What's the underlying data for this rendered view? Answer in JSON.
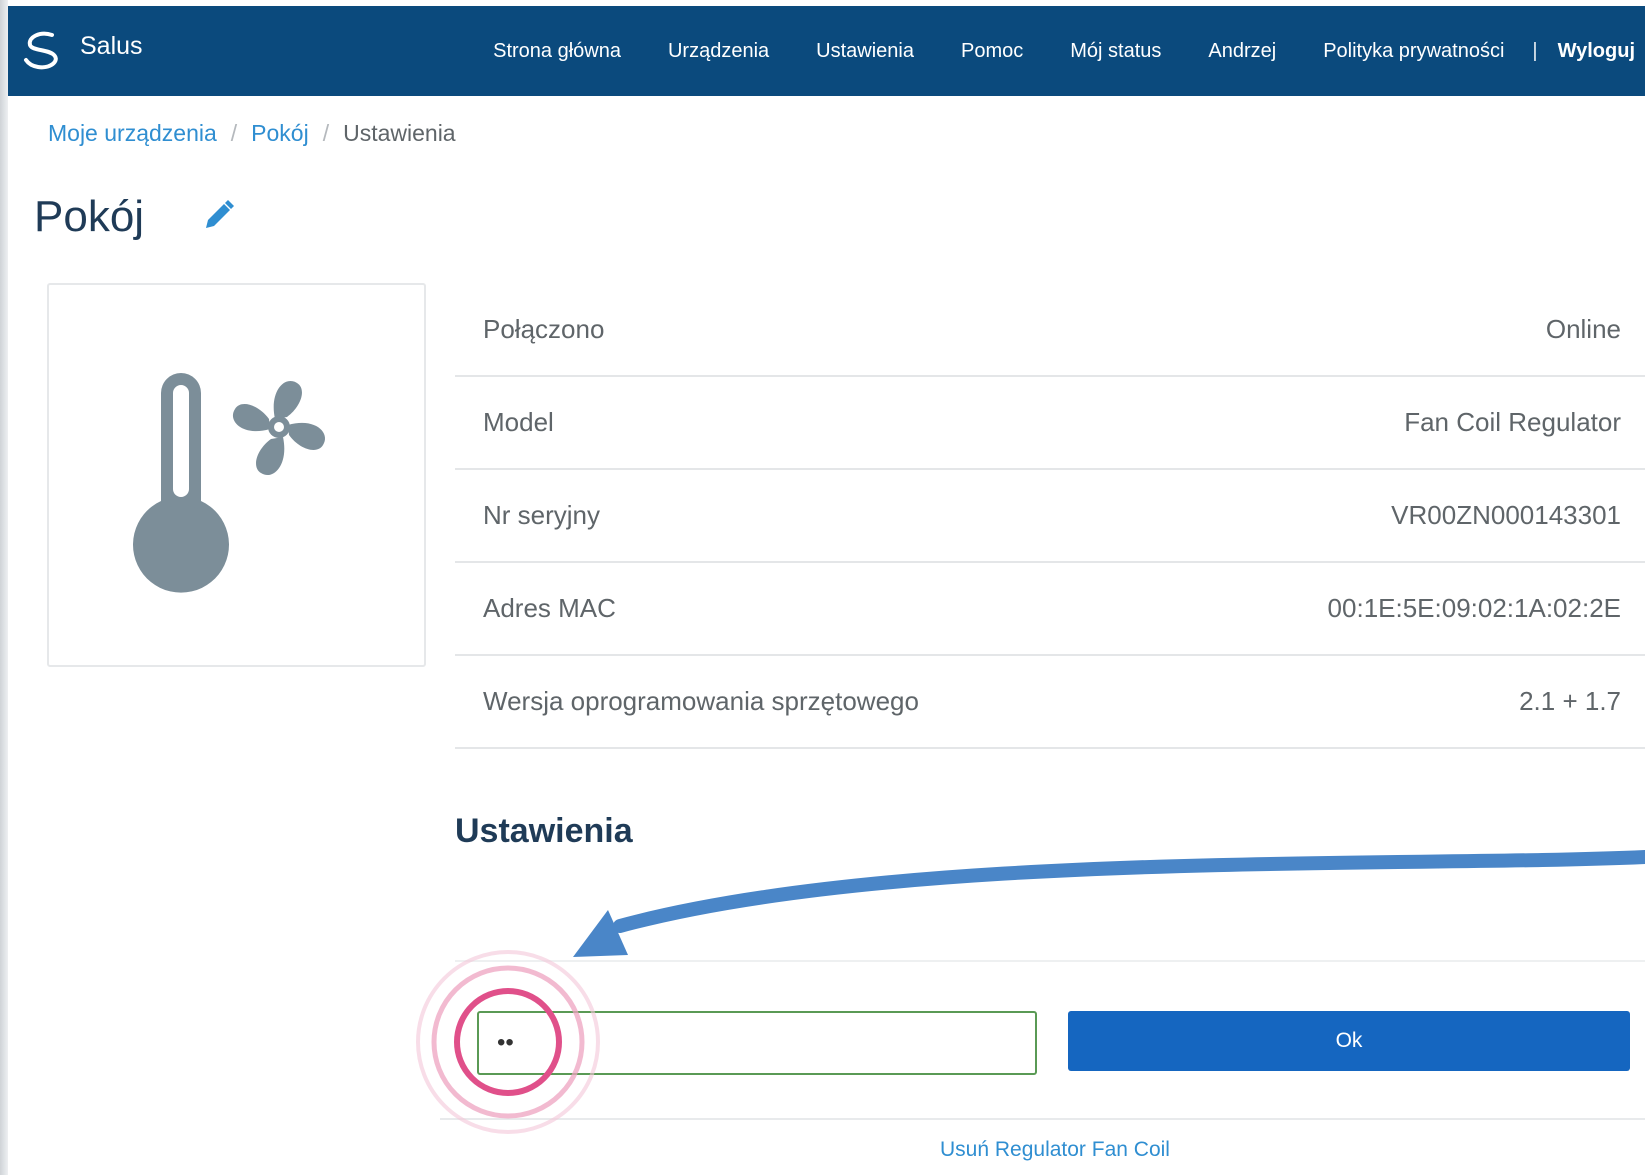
{
  "navbar": {
    "brand": "Salus",
    "items": [
      "Strona główna",
      "Urządzenia",
      "Ustawienia",
      "Pomoc",
      "Mój status",
      "Andrzej",
      "Polityka prywatności"
    ],
    "separator": "|",
    "logout": "Wyloguj"
  },
  "breadcrumb": {
    "items": [
      "Moje urządzenia",
      "Pokój"
    ],
    "separator": "/",
    "current": "Ustawienia"
  },
  "page": {
    "title": "Pokój"
  },
  "device_icon": "thermometer-fan-icon",
  "info": [
    {
      "label": "Połączono",
      "value": "Online"
    },
    {
      "label": "Model",
      "value": "Fan Coil Regulator"
    },
    {
      "label": "Nr seryjny",
      "value": "VR00ZN000143301"
    },
    {
      "label": "Adres MAC",
      "value": "00:1E:5E:09:02:1A:02:2E"
    },
    {
      "label": "Wersja oprogramowania sprzętowego",
      "value": "2.1 + 1.7"
    }
  ],
  "settings": {
    "heading": "Ustawienia",
    "input_value": "••",
    "ok_label": "Ok",
    "delete_link": "Usuń Regulator Fan Coil"
  },
  "colors": {
    "navbar": "#0b4a7d",
    "link": "#2f8ed1",
    "button": "#1566c0",
    "input_border": "#5a9a55",
    "annotation_arrow": "#4a86c8",
    "annotation_circle": "#e0508a"
  }
}
